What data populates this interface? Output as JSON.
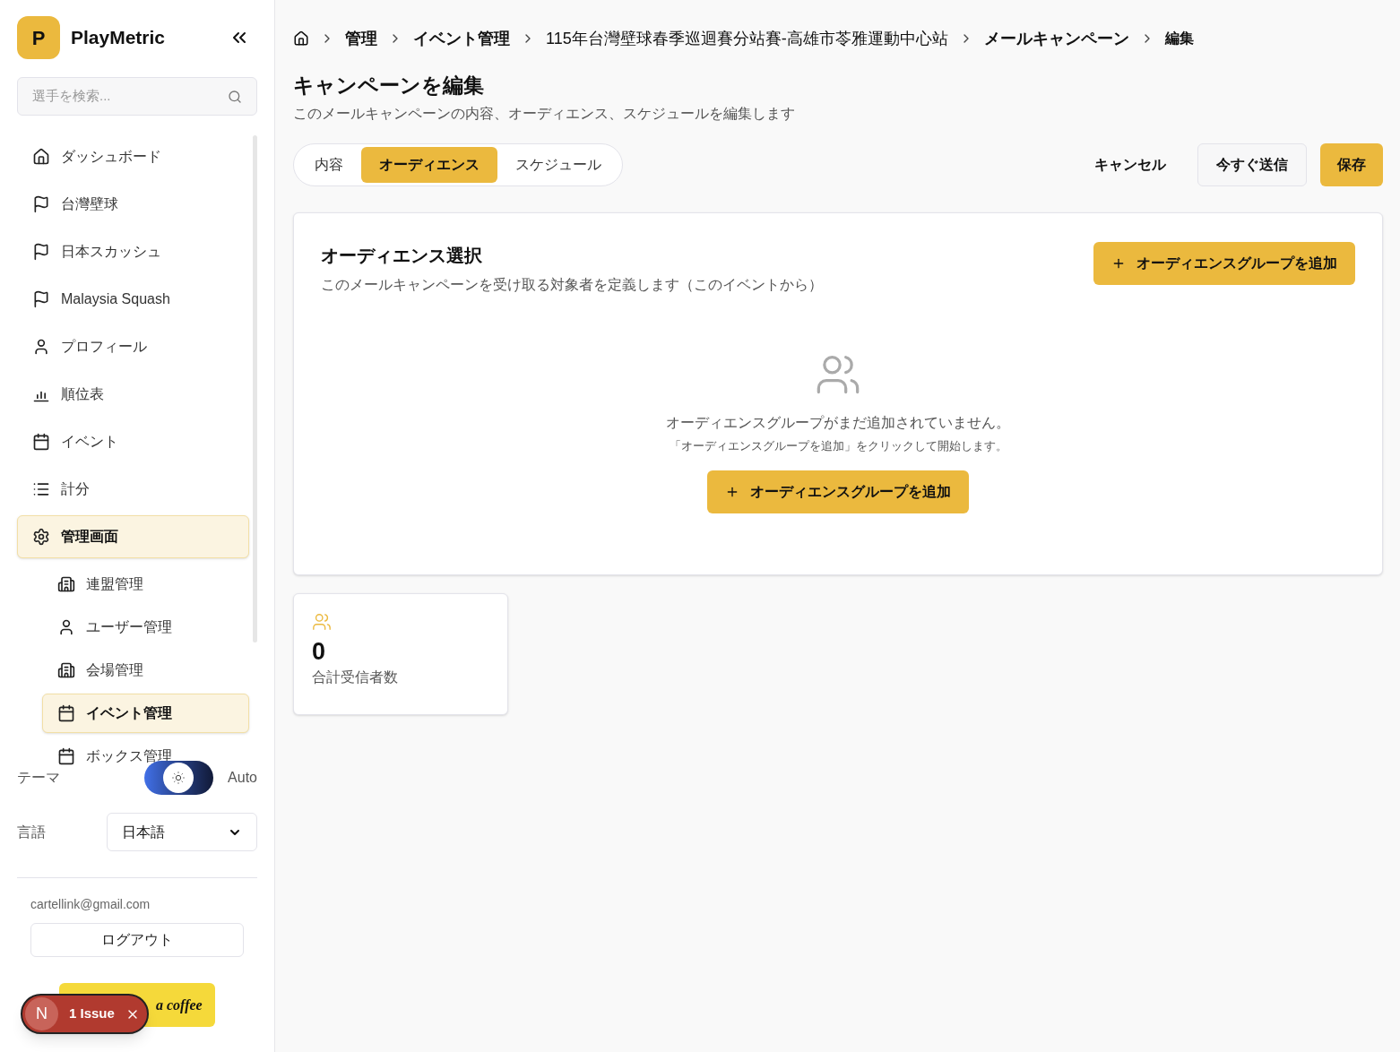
{
  "brand": {
    "logo_letter": "P",
    "name": "PlayMetric"
  },
  "search": {
    "placeholder": "選手を検索..."
  },
  "nav": [
    {
      "label": "ダッシュボード",
      "kind": "home",
      "selected": false
    },
    {
      "label": "台灣壁球",
      "kind": "flag",
      "selected": false
    },
    {
      "label": "日本スカッシュ",
      "kind": "flag",
      "selected": false
    },
    {
      "label": "Malaysia Squash",
      "kind": "flag",
      "selected": false
    },
    {
      "label": "プロフィール",
      "kind": "user",
      "selected": false
    },
    {
      "label": "順位表",
      "kind": "chart",
      "selected": false
    },
    {
      "label": "イベント",
      "kind": "calendar",
      "selected": false
    },
    {
      "label": "計分",
      "kind": "list",
      "selected": false
    },
    {
      "label": "管理画面",
      "kind": "gear",
      "selected": true,
      "children": [
        {
          "label": "連盟管理",
          "kind": "building",
          "selected": false
        },
        {
          "label": "ユーザー管理",
          "kind": "user",
          "selected": false
        },
        {
          "label": "会場管理",
          "kind": "building",
          "selected": false
        },
        {
          "label": "イベント管理",
          "kind": "calendar",
          "selected": true
        },
        {
          "label": "ボックス管理",
          "kind": "calendar",
          "selected": false
        }
      ]
    }
  ],
  "theme": {
    "label": "テーマ",
    "value": "Auto",
    "on": true
  },
  "language": {
    "label": "言語",
    "value": "日本語"
  },
  "account": {
    "email": "cartellink@gmail.com",
    "logout": "ログアウト"
  },
  "coffee_button": {
    "label": "a coffee"
  },
  "issue_badge": {
    "letter": "N",
    "label": "1 Issue"
  },
  "breadcrumbs": [
    "管理",
    "イベント管理",
    "115年台灣壁球春季巡迴賽分站賽-高雄市苓雅運動中心站",
    "メールキャンペーン",
    "編集"
  ],
  "page": {
    "title": "キャンペーンを編集",
    "subtitle": "このメールキャンペーンの内容、オーディエンス、スケジュールを編集します"
  },
  "tabs": [
    {
      "label": "内容",
      "selected": false
    },
    {
      "label": "オーディエンス",
      "selected": true
    },
    {
      "label": "スケジュール",
      "selected": false
    }
  ],
  "actions": {
    "cancel": "キャンセル",
    "send_now": "今すぐ送信",
    "save": "保存"
  },
  "audience": {
    "title": "オーディエンス選択",
    "description": "このメールキャンペーンを受け取る対象者を定義します（このイベントから）",
    "add_button": "オーディエンスグループを追加",
    "empty_title": "オーディエンスグループがまだ追加されていません。",
    "empty_hint": "「オーディエンスグループを追加」をクリックして開始します。",
    "empty_button": "オーディエンスグループを追加"
  },
  "stat": {
    "value": "0",
    "label": "合計受信者数"
  }
}
